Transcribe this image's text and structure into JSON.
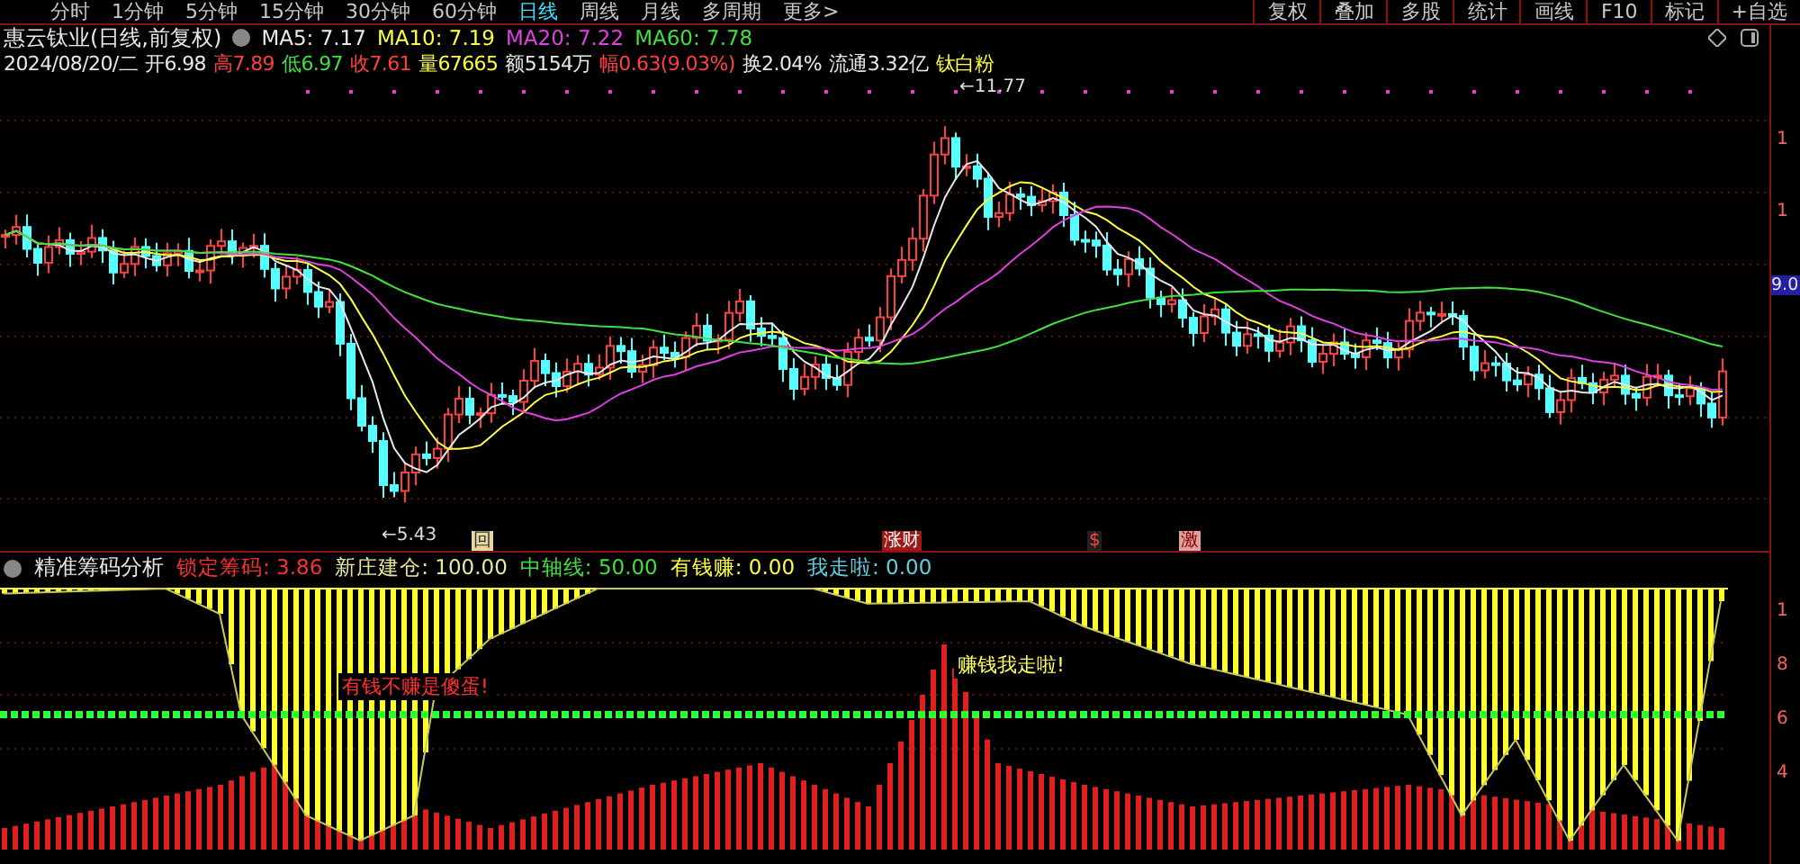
{
  "toolbar": {
    "periods": [
      {
        "label": "分时",
        "selected": false
      },
      {
        "label": "1分钟",
        "selected": false
      },
      {
        "label": "5分钟",
        "selected": false
      },
      {
        "label": "15分钟",
        "selected": false
      },
      {
        "label": "30分钟",
        "selected": false
      },
      {
        "label": "60分钟",
        "selected": false
      },
      {
        "label": "日线",
        "selected": true
      },
      {
        "label": "周线",
        "selected": false
      },
      {
        "label": "月线",
        "selected": false
      },
      {
        "label": "多周期",
        "selected": false
      },
      {
        "label": "更多>",
        "selected": false
      }
    ],
    "tools": [
      "复权",
      "叠加",
      "多股",
      "统计",
      "画线",
      "F10",
      "标记",
      "+自选"
    ]
  },
  "header": {
    "title": "惠云钛业(日线,前复权)",
    "ma": [
      {
        "label": "MA5: 7.17",
        "color": "#e8e8e8"
      },
      {
        "label": "MA10: 7.19",
        "color": "#ffff40"
      },
      {
        "label": "MA20: 7.22",
        "color": "#e040e0"
      },
      {
        "label": "MA60: 7.78",
        "color": "#40e040"
      }
    ]
  },
  "quote": [
    {
      "text": "2024/08/20/二",
      "color": "#e8e8e8"
    },
    {
      "text": "开6.98",
      "color": "#e8e8e8"
    },
    {
      "text": "高7.89",
      "color": "#ff4040"
    },
    {
      "text": "低6.97",
      "color": "#40e040"
    },
    {
      "text": "收7.61",
      "color": "#ff4040"
    },
    {
      "text": "量67665",
      "color": "#ffff40"
    },
    {
      "text": "额5154万",
      "color": "#e8e8e8"
    },
    {
      "text": "幅0.63(9.03%)",
      "color": "#ff4040"
    },
    {
      "text": "换2.04%",
      "color": "#e8e8e8"
    },
    {
      "text": "流通3.32亿",
      "color": "#e8e8e8"
    },
    {
      "text": "钛白粉",
      "color": "#ffff40"
    }
  ],
  "price_chart": {
    "high_label": "←11.77",
    "low_label": "←5.43",
    "markers": [
      "回",
      "涨财",
      "$",
      "激"
    ],
    "axis_labels": [
      "1",
      "1"
    ],
    "current_price": "9.0"
  },
  "indicator": {
    "title": "精准筹码分析",
    "values": [
      {
        "text": "锁定筹码: 3.86",
        "color": "#ff3030"
      },
      {
        "text": "新庄建仓: 100.00",
        "color": "#e8e8a0"
      },
      {
        "text": "中轴线: 50.00",
        "color": "#40e040"
      },
      {
        "text": "有钱赚: 0.00",
        "color": "#ffff40"
      },
      {
        "text": "我走啦: 0.00",
        "color": "#60d0e0"
      }
    ],
    "signals": [
      "有钱不赚是傻蛋!",
      "赚钱我走啦!"
    ],
    "axis_labels": [
      "1",
      "8",
      "6",
      "4"
    ]
  }
}
